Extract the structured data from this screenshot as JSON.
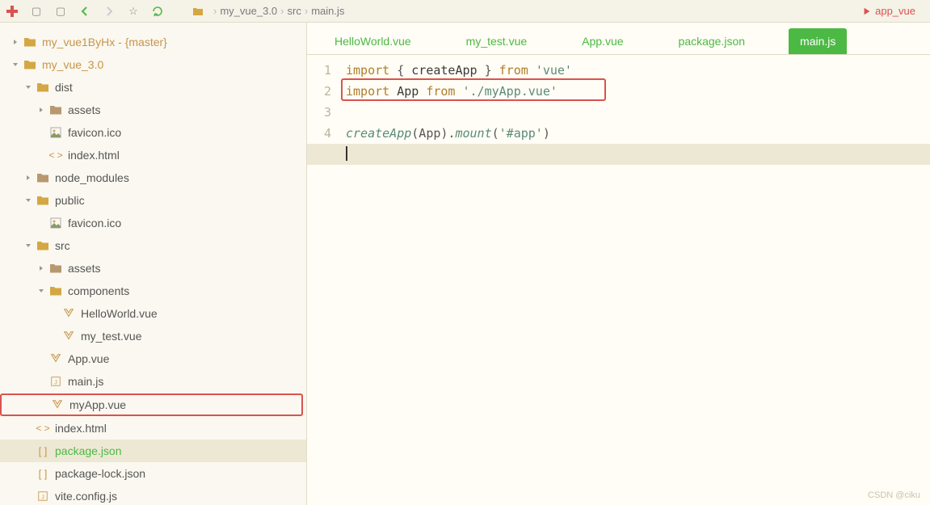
{
  "toolbar": {
    "breadcrumb": [
      "my_vue_3.0",
      "src",
      "main.js"
    ],
    "rightTab": "app_vue"
  },
  "tree": [
    {
      "depth": 0,
      "arrow": "right",
      "iconType": "folder",
      "label": "my_vue1ByHx - {master}",
      "name": "tree-my-vue1byhx",
      "color": "#d4a744"
    },
    {
      "depth": 0,
      "arrow": "down",
      "iconType": "folder",
      "label": "my_vue_3.0",
      "name": "tree-my-vue-30",
      "color": "#d4a744"
    },
    {
      "depth": 1,
      "arrow": "down",
      "iconType": "folder",
      "label": "dist",
      "name": "tree-dist",
      "color": "#d4a744"
    },
    {
      "depth": 2,
      "arrow": "right",
      "iconType": "folder-closed",
      "label": "assets",
      "name": "tree-dist-assets",
      "color": "#b89870"
    },
    {
      "depth": 2,
      "arrow": "",
      "iconType": "image",
      "label": "favicon.ico",
      "name": "tree-favicon-dist"
    },
    {
      "depth": 2,
      "arrow": "",
      "iconType": "html",
      "label": "index.html",
      "name": "tree-index-dist"
    },
    {
      "depth": 1,
      "arrow": "right",
      "iconType": "folder-closed",
      "label": "node_modules",
      "name": "tree-node-modules",
      "color": "#b89870"
    },
    {
      "depth": 1,
      "arrow": "down",
      "iconType": "folder",
      "label": "public",
      "name": "tree-public",
      "color": "#d4a744"
    },
    {
      "depth": 2,
      "arrow": "",
      "iconType": "image",
      "label": "favicon.ico",
      "name": "tree-favicon-public"
    },
    {
      "depth": 1,
      "arrow": "down",
      "iconType": "folder",
      "label": "src",
      "name": "tree-src",
      "color": "#d4a744"
    },
    {
      "depth": 2,
      "arrow": "right",
      "iconType": "folder-closed",
      "label": "assets",
      "name": "tree-src-assets",
      "color": "#b89870"
    },
    {
      "depth": 2,
      "arrow": "down",
      "iconType": "folder",
      "label": "components",
      "name": "tree-components",
      "color": "#d4a744"
    },
    {
      "depth": 3,
      "arrow": "",
      "iconType": "vue",
      "label": "HelloWorld.vue",
      "name": "tree-helloworld"
    },
    {
      "depth": 3,
      "arrow": "",
      "iconType": "vue",
      "label": "my_test.vue",
      "name": "tree-mytest"
    },
    {
      "depth": 2,
      "arrow": "",
      "iconType": "vue",
      "label": "App.vue",
      "name": "tree-app"
    },
    {
      "depth": 2,
      "arrow": "",
      "iconType": "js",
      "label": "main.js",
      "name": "tree-mainjs"
    },
    {
      "depth": 2,
      "arrow": "",
      "iconType": "vue",
      "label": "myApp.vue",
      "name": "tree-myapp",
      "highlighted": true
    },
    {
      "depth": 1,
      "arrow": "",
      "iconType": "html",
      "label": "index.html",
      "name": "tree-index-root"
    },
    {
      "depth": 1,
      "arrow": "",
      "iconType": "json",
      "label": "package.json",
      "name": "tree-packagejson",
      "selected": true
    },
    {
      "depth": 1,
      "arrow": "",
      "iconType": "json",
      "label": "package-lock.json",
      "name": "tree-packagelock"
    },
    {
      "depth": 1,
      "arrow": "",
      "iconType": "js",
      "label": "vite.config.js",
      "name": "tree-viteconfig"
    }
  ],
  "tabs": [
    {
      "label": "HelloWorld.vue",
      "name": "tab-helloworld"
    },
    {
      "label": "my_test.vue",
      "name": "tab-mytest"
    },
    {
      "label": "App.vue",
      "name": "tab-app"
    },
    {
      "label": "package.json",
      "name": "tab-packagejson"
    },
    {
      "label": "main.js",
      "name": "tab-mainjs",
      "active": true
    }
  ],
  "code": {
    "lines": [
      [
        {
          "t": "import",
          "c": "kw"
        },
        {
          "t": " { ",
          "c": "punct"
        },
        {
          "t": "createApp",
          "c": "ident"
        },
        {
          "t": " } ",
          "c": "punct"
        },
        {
          "t": "from",
          "c": "kw"
        },
        {
          "t": " ",
          "c": "punct"
        },
        {
          "t": "'vue'",
          "c": "str"
        }
      ],
      [
        {
          "t": "import",
          "c": "kw"
        },
        {
          "t": " App ",
          "c": "ident"
        },
        {
          "t": "from",
          "c": "kw"
        },
        {
          "t": " ",
          "c": "punct"
        },
        {
          "t": "'./myApp.vue'",
          "c": "str"
        }
      ],
      [],
      [
        {
          "t": "createApp",
          "c": "fn"
        },
        {
          "t": "(App).",
          "c": "punct"
        },
        {
          "t": "mount",
          "c": "fn"
        },
        {
          "t": "(",
          "c": "punct"
        },
        {
          "t": "'#app'",
          "c": "str"
        },
        {
          "t": ")",
          "c": "punct"
        }
      ],
      [
        {
          "t": "",
          "c": "cursor"
        }
      ]
    ],
    "lineCount": 5
  },
  "watermark": "CSDN @ciku"
}
